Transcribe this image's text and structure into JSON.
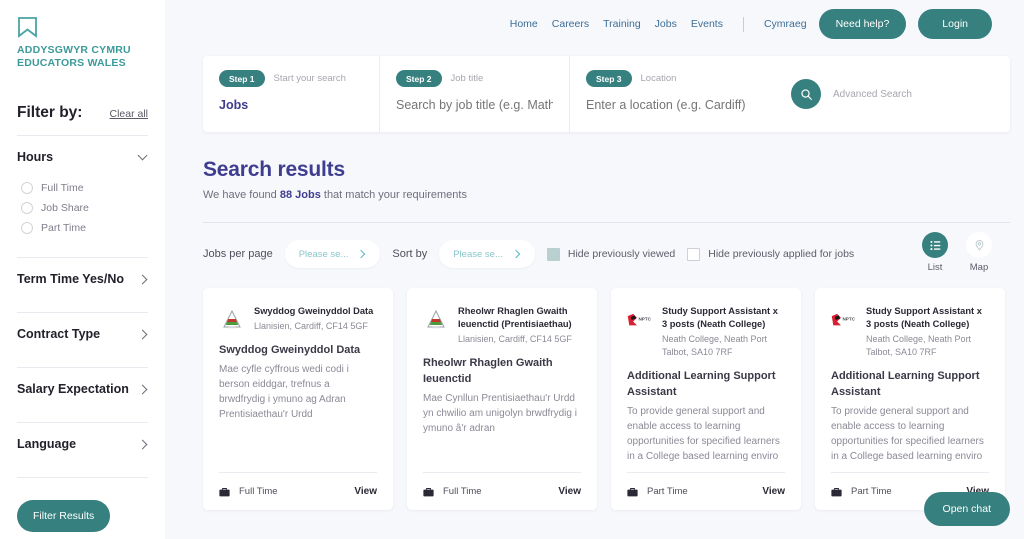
{
  "brand": {
    "logo_icon": "bookmark-icon",
    "name_cy": "ADDYSGWYR CYMRU",
    "name_en": "EDUCATORS WALES",
    "teal": "#36807f",
    "indigo": "#3e3d8f"
  },
  "sidebar": {
    "filter_title": "Filter by:",
    "clear_all": "Clear all",
    "filter_button": "Filter Results",
    "groups": [
      {
        "label": "Hours",
        "expanded": true,
        "options": [
          "Full Time",
          "Job Share",
          "Part Time"
        ]
      },
      {
        "label": "Term Time Yes/No",
        "expanded": false,
        "options": []
      },
      {
        "label": "Contract Type",
        "expanded": false,
        "options": []
      },
      {
        "label": "Salary Expectation",
        "expanded": false,
        "options": []
      },
      {
        "label": "Language",
        "expanded": false,
        "options": []
      }
    ]
  },
  "topnav": {
    "links": [
      "Home",
      "Careers",
      "Training",
      "Jobs",
      "Events"
    ],
    "language_link": "Cymraeg",
    "help_button": "Need help?",
    "login_button": "Login"
  },
  "searchbar": {
    "steps": [
      {
        "pill": "Step 1",
        "hint": "Start your search",
        "value": "Jobs",
        "placeholder": ""
      },
      {
        "pill": "Step 2",
        "hint": "Job title",
        "value": "",
        "placeholder": "Search by job title (e.g. Maths Teacher)"
      },
      {
        "pill": "Step 3",
        "hint": "Location",
        "value": "",
        "placeholder": "Enter a location (e.g. Cardiff)"
      }
    ],
    "advanced_search": "Advanced Search",
    "search_icon": "magnifier-icon"
  },
  "results": {
    "title": "Search results",
    "found_prefix": "We have found ",
    "count": "88 Jobs",
    "found_suffix": " that match your requirements"
  },
  "controls": {
    "jobs_per_page_label": "Jobs per page",
    "jobs_per_page_value": "Please se...",
    "sort_by_label": "Sort by",
    "sort_by_value": "Please se...",
    "hide_viewed_label": "Hide previously viewed",
    "hide_viewed_checked": true,
    "hide_applied_label": "Hide previously applied for jobs",
    "hide_applied_checked": false,
    "view_list_label": "List",
    "view_map_label": "Map",
    "active_view": "List"
  },
  "cards": [
    {
      "logo": "urdd-logo",
      "org_title": "Swyddog Gweinyddol Data",
      "location": "Llanisien, Cardiff, CF14 5GF",
      "title": "Swyddog Gweinyddol Data",
      "description": "Mae cyfle cyffrous wedi codi i berson eiddgar, trefnus a brwdfrydig i ymuno ag Adran Prentisiaethau'r Urdd",
      "type": "Full Time",
      "view": "View"
    },
    {
      "logo": "urdd-logo",
      "org_title": "Rheolwr Rhaglen Gwaith Ieuenctid (Prentisiaethau)",
      "location": "Llanisien, Cardiff, CF14 5GF",
      "title": "Rheolwr Rhaglen Gwaith Ieuenctid",
      "description": "Mae Cynllun Prentisiaethau'r Urdd yn chwilio am unigolyn brwdfrydig i ymuno â'r adran",
      "type": "Full Time",
      "view": "View"
    },
    {
      "logo": "nptc-logo",
      "org_title": "Study Support Assistant x 3 posts (Neath College)",
      "location": "Neath College, Neath Port Talbot, SA10 7RF",
      "title": "Additional Learning Support Assistant",
      "description": "To provide general support and enable access to learning opportunities for specified learners in a College based learning enviro",
      "type": "Part Time",
      "view": "View"
    },
    {
      "logo": "nptc-logo",
      "org_title": "Study Support Assistant x 3 posts (Neath College)",
      "location": "Neath College, Neath Port Talbot, SA10 7RF",
      "title": "Additional Learning Support Assistant",
      "description": "To provide general support and enable access to learning opportunities for specified learners in a College based learning enviro",
      "type": "Part Time",
      "view": "View"
    }
  ],
  "chat": {
    "button": "Open chat"
  }
}
